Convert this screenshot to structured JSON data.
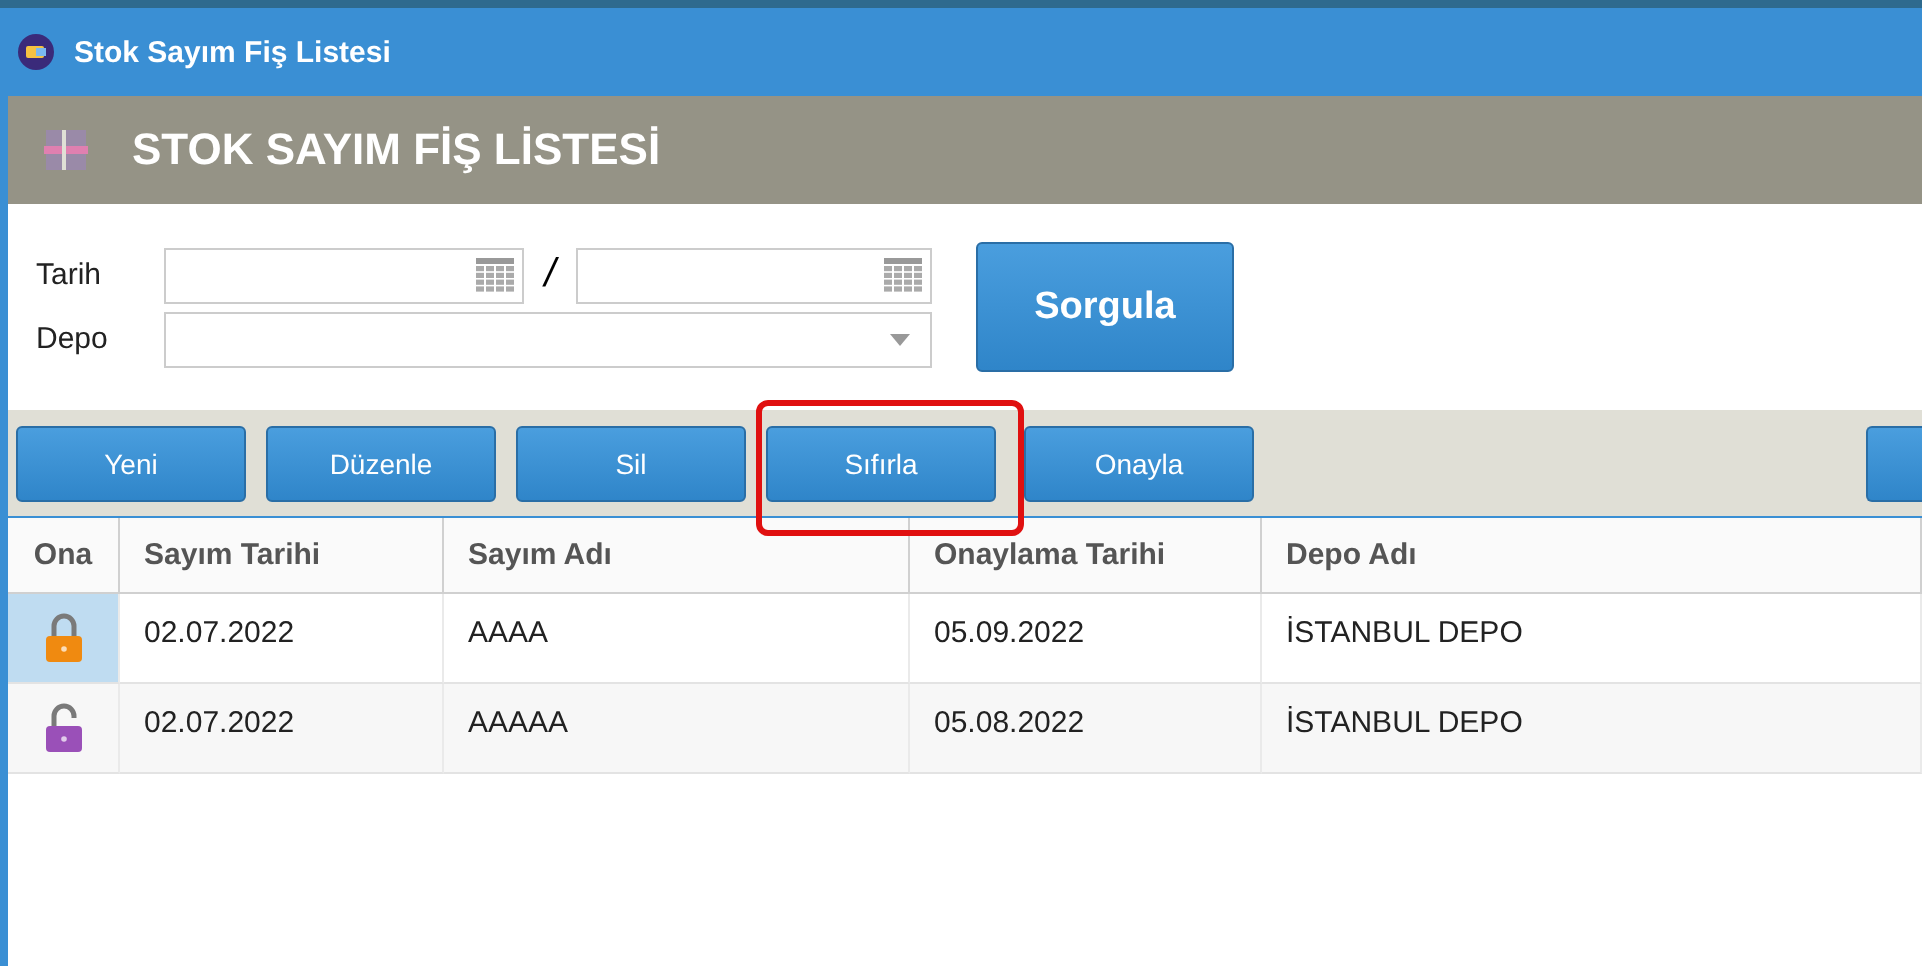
{
  "window": {
    "title": "Stok Sayım Fiş Listesi"
  },
  "page_header": {
    "title": "STOK SAYIM FİŞ LİSTESİ"
  },
  "filters": {
    "date_label": "Tarih",
    "date_separator": "/",
    "depot_label": "Depo",
    "query_button": "Sorgula"
  },
  "toolbar": {
    "buttons": [
      {
        "label": "Yeni"
      },
      {
        "label": "Düzenle"
      },
      {
        "label": "Sil"
      },
      {
        "label": "Sıfırla",
        "highlighted": true
      },
      {
        "label": "Onayla"
      }
    ]
  },
  "table": {
    "columns": [
      "Ona",
      "Sayım Tarihi",
      "Sayım Adı",
      "Onaylama Tarihi",
      "Depo Adı"
    ],
    "rows": [
      {
        "locked": true,
        "selected": true,
        "cells": [
          "",
          "02.07.2022",
          "AAAA",
          "05.09.2022",
          "İSTANBUL DEPO"
        ]
      },
      {
        "locked": false,
        "selected": false,
        "cells": [
          "",
          "02.07.2022",
          "AAAAA",
          "05.08.2022",
          "İSTANBUL DEPO"
        ]
      }
    ]
  }
}
